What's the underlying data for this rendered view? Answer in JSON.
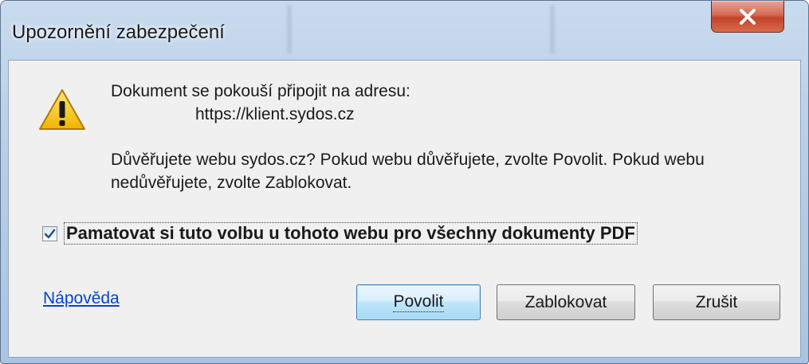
{
  "window": {
    "title": "Upozornění zabezpečení"
  },
  "message": {
    "line1": "Dokument se pokouší připojit na adresu:",
    "url": "https://klient.sydos.cz",
    "line2": "Důvěřujete webu sydos.cz? Pokud webu důvěřujete, zvolte Povolit. Pokud webu",
    "line3": "nedůvěřujete, zvolte Zablokovat."
  },
  "remember": {
    "label": "Pamatovat si tuto volbu u tohoto webu pro všechny dokumenty PDF",
    "checked": true
  },
  "help": {
    "label": "Nápověda"
  },
  "buttons": {
    "allow": "Povolit",
    "block": "Zablokovat",
    "cancel": "Zrušit"
  },
  "icons": {
    "warning": "warning-icon",
    "close": "close-icon",
    "checkmark": "checkmark-icon"
  },
  "colors": {
    "link": "#0046d5",
    "close_button": "#c2432a",
    "default_button_border": "#3c7fb1",
    "warning_fill": "#f5c400"
  }
}
